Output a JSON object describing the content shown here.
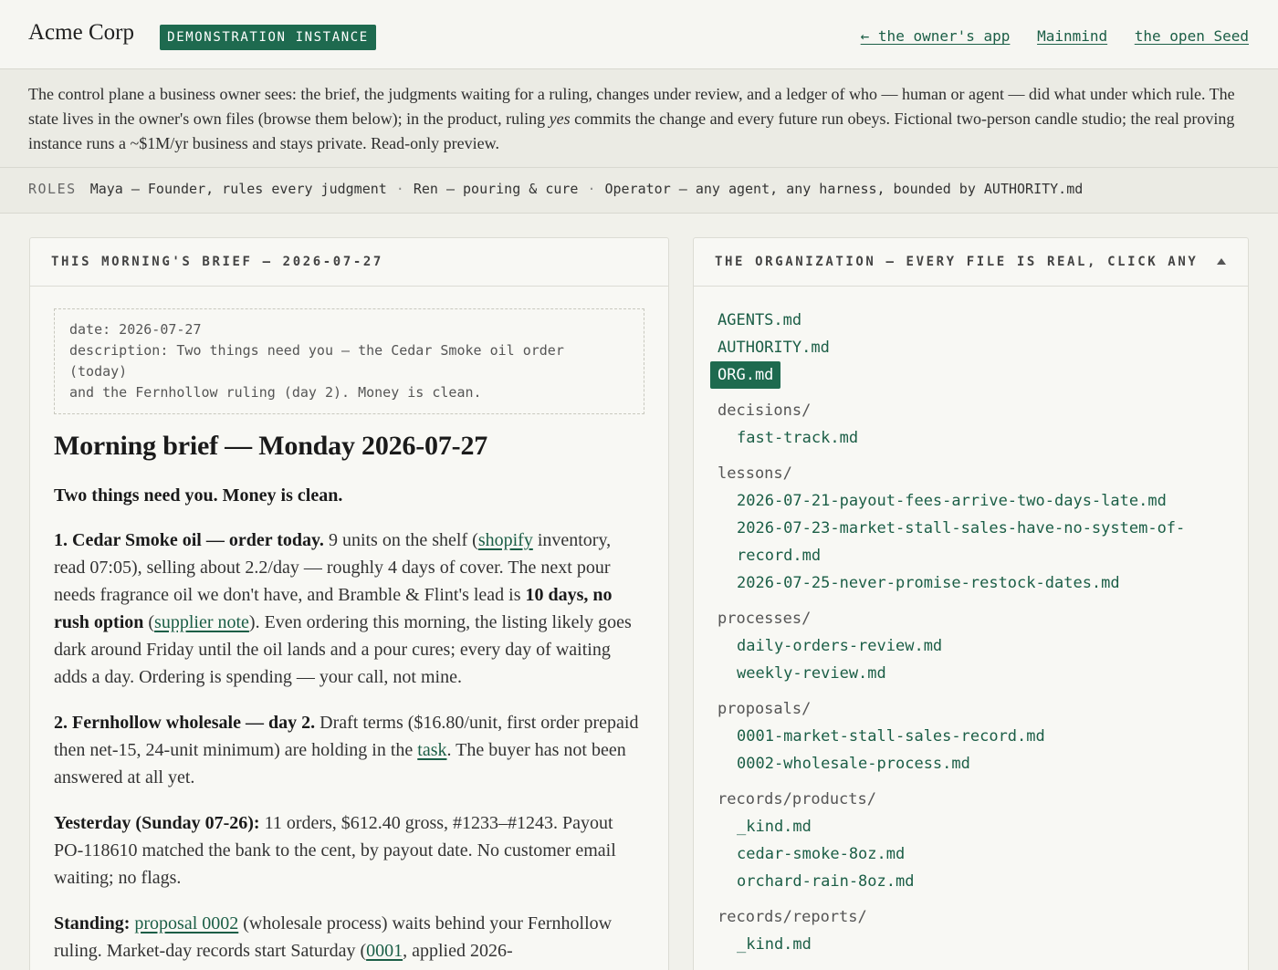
{
  "header": {
    "brand": "Acme Corp",
    "badge": "DEMONSTRATION INSTANCE",
    "nav": [
      "← the owner's app",
      "Mainmind",
      "the open Seed"
    ]
  },
  "intro": {
    "part1": "The control plane a business owner sees: the brief, the judgments waiting for a ruling, changes under review, and a ledger of who — human or agent — did what under which rule. The state lives in the owner's own files (browse them below); in the product, ruling ",
    "emph": "yes",
    "part2": " commits the change and every future run obeys. Fictional two-person candle studio; the real proving instance runs a ~$1M/yr business and stays private. Read-only preview."
  },
  "roles": {
    "label": "ROLES",
    "items": [
      "Maya — Founder, rules every judgment",
      "Ren — pouring & cure",
      "Operator — any agent, any harness, bounded by AUTHORITY.md"
    ],
    "separator": "·"
  },
  "brief": {
    "panel_title": "THIS MORNING'S BRIEF — 2026-07-27",
    "frontmatter": {
      "date": "date: 2026-07-27",
      "description_line1": "description: Two things need you — the Cedar Smoke oil order (today)",
      "description_line2": "and the Fernhollow ruling (day 2). Money is clean."
    },
    "title": "Morning brief — Monday 2026-07-27",
    "summary": "Two things need you. Money is clean.",
    "item1": {
      "lead": "1. Cedar Smoke oil — order today.",
      "t1": " 9 units on the shelf (",
      "link1": "shopify",
      "t2": " inventory, read 07:05), selling about 2.2/day — roughly 4 days of cover. The next pour needs fragrance oil we don't have, and Bramble & Flint's lead is ",
      "bold": "10 days, no rush option",
      "t3": " (",
      "link2": "supplier note",
      "t4": "). Even ordering this morning, the listing likely goes dark around Friday until the oil lands and a pour cures; every day of waiting adds a day. Ordering is spending — your call, not mine."
    },
    "item2": {
      "lead": "2. Fernhollow wholesale — day 2.",
      "t1": " Draft terms ($16.80/unit, first order prepaid then net-15, 24-unit minimum) are holding in the ",
      "link": "task",
      "t2": ". The buyer has not been answered at all yet."
    },
    "yesterday": {
      "lead": "Yesterday (Sunday 07-26):",
      "text": " 11 orders, $612.40 gross, #1233–#1243. Payout PO-118610 matched the bank to the cent, by payout date. No customer email waiting; no flags."
    },
    "standing": {
      "lead": "Standing:",
      "t0": " ",
      "link1": "proposal 0002",
      "t1": " (wholesale process) waits behind your Fernhollow ruling. Market-day records start Saturday (",
      "link2": "0001",
      "t2": ", applied 2026-"
    }
  },
  "org": {
    "panel_title": "THE ORGANIZATION — EVERY FILE IS REAL, CLICK ANY",
    "root_files": [
      "AGENTS.md",
      "AUTHORITY.md"
    ],
    "active_file": "ORG.md",
    "dirs": [
      {
        "name": "decisions/",
        "files": [
          "fast-track.md"
        ]
      },
      {
        "name": "lessons/",
        "files": [
          "2026-07-21-payout-fees-arrive-two-days-late.md",
          "2026-07-23-market-stall-sales-have-no-system-of-",
          "record.md",
          "2026-07-25-never-promise-restock-dates.md"
        ]
      },
      {
        "name": "processes/",
        "files": [
          "daily-orders-review.md",
          "weekly-review.md"
        ]
      },
      {
        "name": "proposals/",
        "files": [
          "0001-market-stall-sales-record.md",
          "0002-wholesale-process.md"
        ]
      },
      {
        "name": "records/products/",
        "files": [
          "_kind.md",
          "cedar-smoke-8oz.md",
          "orchard-rain-8oz.md"
        ]
      },
      {
        "name": "records/reports/",
        "files": [
          "_kind.md"
        ]
      }
    ]
  }
}
